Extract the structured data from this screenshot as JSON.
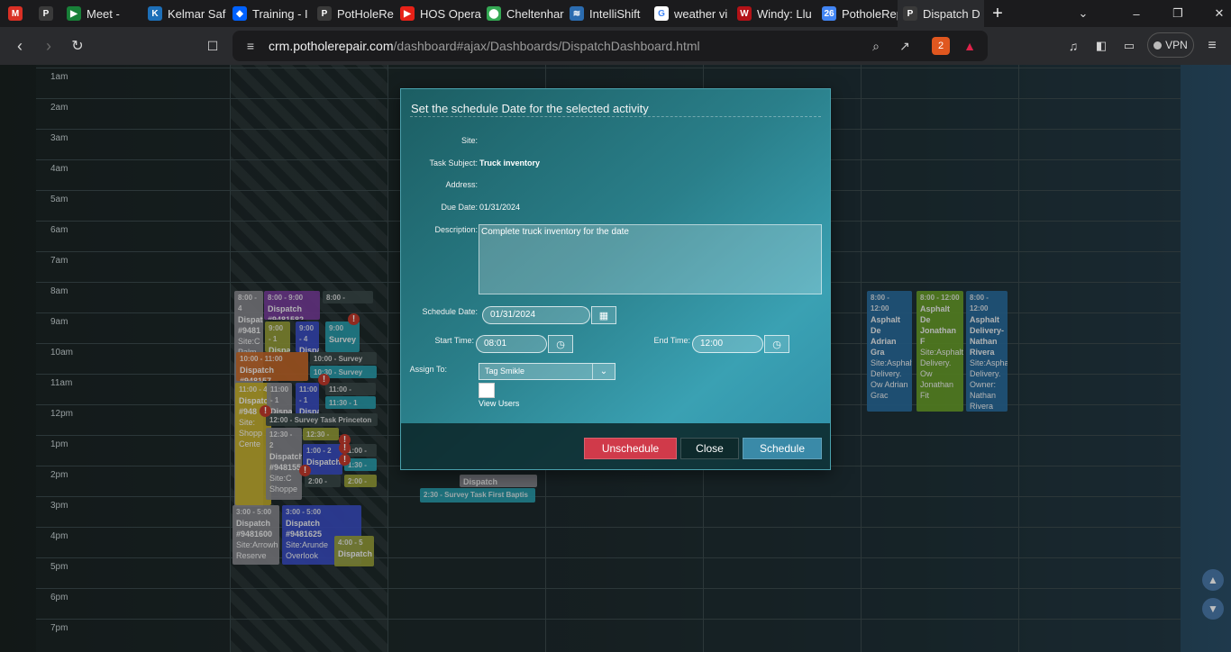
{
  "browser": {
    "tabs": [
      {
        "label": "",
        "icon": "gmail-icon",
        "color": "#d93025",
        "glyph": "M",
        "pinned": true
      },
      {
        "label": "",
        "icon": "potholerepair-icon",
        "color": "#3a3a3a",
        "glyph": "P",
        "pinned": true
      },
      {
        "label": "Meet -",
        "icon": "meet-icon",
        "color": "#188038",
        "glyph": "▶"
      },
      {
        "label": "Kelmar Saf",
        "icon": "kelmar-icon",
        "color": "#1d6fb8",
        "glyph": "K"
      },
      {
        "label": "Training - I",
        "icon": "dropbox-icon",
        "color": "#0061fe",
        "glyph": "◆"
      },
      {
        "label": "PotHoleRe",
        "icon": "potholerepair-icon",
        "color": "#3a3a3a",
        "glyph": "P"
      },
      {
        "label": "HOS Opera",
        "icon": "youtube-icon",
        "color": "#e62117",
        "glyph": "▶"
      },
      {
        "label": "Cheltenhar",
        "icon": "maps-icon",
        "color": "#34a853",
        "glyph": "⬤"
      },
      {
        "label": "IntelliShift",
        "icon": "intellishift-icon",
        "color": "#2b6cb0",
        "glyph": "≋"
      },
      {
        "label": "weather vi",
        "icon": "google-icon",
        "color": "#ffffff",
        "glyph": "G"
      },
      {
        "label": "Windy: Llu",
        "icon": "windy-icon",
        "color": "#b31217",
        "glyph": "W"
      },
      {
        "label": "PotholeRep",
        "icon": "calendar-icon",
        "color": "#4285f4",
        "glyph": "26"
      },
      {
        "label": "Dispatch D",
        "icon": "potholerepair-icon",
        "color": "#3a3a3a",
        "glyph": "P",
        "active": true
      }
    ],
    "url_host": "crm.potholerepair.com",
    "url_path": "/dashboard#ajax/Dashboards/DispatchDashboard.html",
    "vpn_label": "VPN",
    "brave_badge": "2"
  },
  "calendar": {
    "hours": [
      "1am",
      "2am",
      "3am",
      "4am",
      "5am",
      "6am",
      "7am",
      "8am",
      "9am",
      "10am",
      "11am",
      "12pm",
      "1pm",
      "2pm",
      "3pm",
      "4pm",
      "5pm",
      "6pm",
      "7pm"
    ],
    "events": [
      {
        "id": "e1",
        "time": "8:00 - 4",
        "title": "Dispatch #9481",
        "site": "Site:C Palm",
        "color": "#8a8a90"
      },
      {
        "id": "e2",
        "time": "8:00 - 9:00",
        "title": "Dispatch #9481582",
        "site": "",
        "color": "#7b3fa0"
      },
      {
        "id": "e3",
        "time": "8:00 - Survey",
        "title": "",
        "site": "",
        "color": "#3c4a4a"
      },
      {
        "id": "e4",
        "time": "9:00 - 1",
        "title": "Dispa",
        "site": "",
        "color": "#9aa23a"
      },
      {
        "id": "e5",
        "time": "9:00 - 4",
        "title": "Dispa",
        "site": "",
        "color": "#3b4fc8"
      },
      {
        "id": "e6",
        "time": "9:00",
        "title": "Survey",
        "site": "",
        "color": "#2aa0b0"
      },
      {
        "id": "e7",
        "time": "10:00 - 11:00",
        "title": "Dispatch #948157",
        "site": "",
        "color": "#c86a2a"
      },
      {
        "id": "e8",
        "time": "10:00 - Survey Tas",
        "title": "",
        "site": "",
        "color": "#3c4a4a"
      },
      {
        "id": "e9",
        "time": "10:30 - Survey Tas",
        "title": "",
        "site": "",
        "color": "#2aa0b0"
      },
      {
        "id": "e10",
        "time": "11:00 - 4",
        "title": "Dispatch #948",
        "site": "Site: Shopp Cente",
        "color": "#c7b02a"
      },
      {
        "id": "e11",
        "time": "11:00 - 1",
        "title": "Dispa",
        "site": "",
        "color": "#8a8a90"
      },
      {
        "id": "e12",
        "time": "11:00 - 1",
        "title": "Dispa",
        "site": "",
        "color": "#3b4fc8"
      },
      {
        "id": "e13",
        "time": "11:00 - Survey",
        "title": "",
        "site": "",
        "color": "#3c4a4a"
      },
      {
        "id": "e14",
        "time": "11:30 - 1",
        "title": "",
        "site": "",
        "color": "#2aa0b0"
      },
      {
        "id": "e15",
        "time": "12:00 - Survey Task Princeton I",
        "title": "",
        "site": "",
        "color": "#3c4a4a"
      },
      {
        "id": "e16",
        "time": "12:30 - 2",
        "title": "Dispatch #948155",
        "site": "Site:C Shoppe",
        "color": "#8a8a90"
      },
      {
        "id": "e17",
        "time": "12:30 - 1",
        "title": "",
        "site": "",
        "color": "#9aa23a"
      },
      {
        "id": "e18",
        "time": "1:00 - 2",
        "title": "Dispatch",
        "site": "",
        "color": "#3b4fc8"
      },
      {
        "id": "e19",
        "time": "1:00 - Su",
        "title": "",
        "site": "",
        "color": "#3c4a4a"
      },
      {
        "id": "e20",
        "time": "1:30 - Su",
        "title": "",
        "site": "",
        "color": "#2aa0b0"
      },
      {
        "id": "e21",
        "time": "2:00 - Sur",
        "title": "",
        "site": "",
        "color": "#3c4a4a"
      },
      {
        "id": "e22",
        "time": "2:00 - Su",
        "title": "",
        "site": "",
        "color": "#9aa23a"
      },
      {
        "id": "e23",
        "time": "",
        "title": "Dispatch",
        "site": "",
        "color": "#8a8a90"
      },
      {
        "id": "e24",
        "time": "2:30 - Survey Task First Baptis",
        "title": "",
        "site": "",
        "color": "#2aa0b0"
      },
      {
        "id": "e25",
        "time": "3:00 - 5:00",
        "title": "Dispatch #9481600",
        "site": "Site:Arrowh Reserve",
        "color": "#8a8a90"
      },
      {
        "id": "e26",
        "time": "3:00 - 5:00",
        "title": "Dispatch #9481625",
        "site": "Site:Arunde Overlook",
        "color": "#3b4fc8"
      },
      {
        "id": "e27",
        "time": "4:00 - 5",
        "title": "Dispatch",
        "site": "",
        "color": "#9aa23a"
      },
      {
        "id": "e28",
        "time": "8:00 - 12:00",
        "title": "Asphalt De Adrian Gra",
        "site": "Site:Asphalt Delivery. Ow Adrian Grac",
        "color": "#2a6ea0"
      },
      {
        "id": "e29",
        "time": "8:00 - 12:00",
        "title": "Asphalt De Jonathan F",
        "site": "Site:Asphalt Delivery. Ow Jonathan Fit",
        "color": "#6aa22a"
      },
      {
        "id": "e30",
        "time": "8:00 - 12:00",
        "title": "Asphalt Delivery- Nathan Rivera",
        "site": "Site:Aspha Delivery. Owner: Nathan Rivera",
        "color": "#2a6ea0"
      }
    ]
  },
  "modal": {
    "title": "Set the schedule Date for the selected activity",
    "labels": {
      "site": "Site:",
      "task_subject": "Task Subject:",
      "address": "Address:",
      "due_date": "Due Date:",
      "description": "Description:",
      "schedule_date": "Schedule Date:",
      "start_time": "Start Time:",
      "end_time": "End Time:",
      "assign_to": "Assign To:",
      "view_users": "View Users"
    },
    "values": {
      "site": "",
      "task_subject": "Truck inventory",
      "address": "",
      "due_date": "01/31/2024",
      "description": "Complete truck inventory for the date",
      "schedule_date": "01/31/2024",
      "start_time": "08:01",
      "end_time": "12:00",
      "assign_to": "Tag Smikle"
    },
    "buttons": {
      "unschedule": "Unschedule",
      "close": "Close",
      "schedule": "Schedule"
    },
    "colors": {
      "unschedule": "#d03a4a",
      "close": "#0e2a2c",
      "schedule": "#3a8aa8"
    }
  }
}
